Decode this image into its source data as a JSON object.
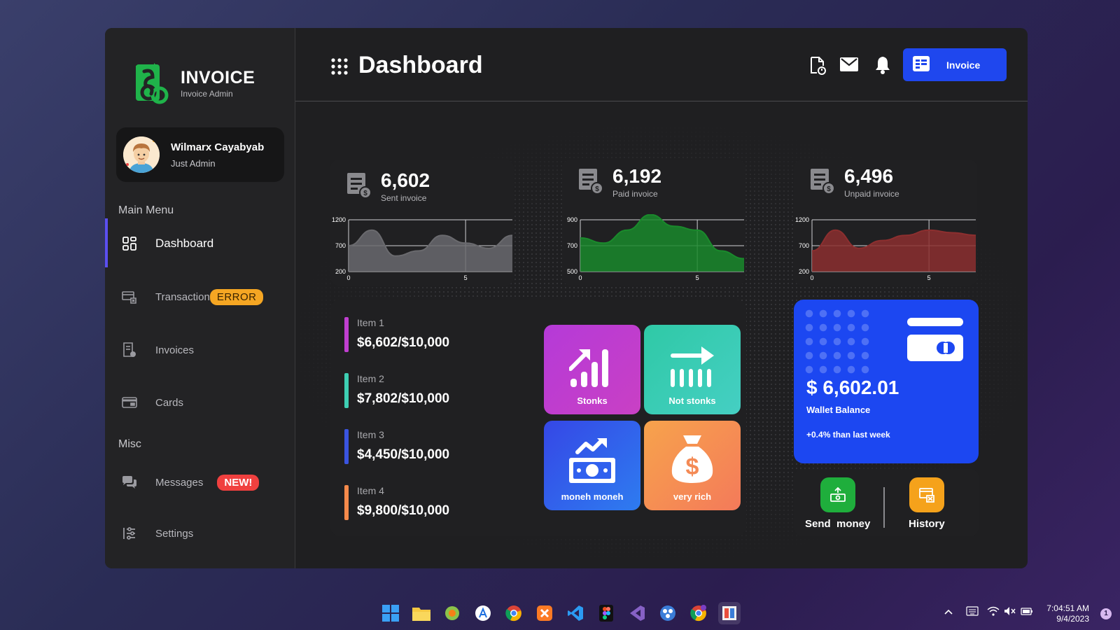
{
  "app": {
    "logo_title": "INVOICE",
    "logo_subtitle": "Invoice Admin"
  },
  "profile": {
    "name": "Wilmarx Cayabyab",
    "role": "Just Admin"
  },
  "sidebar": {
    "main_menu_label": "Main Menu",
    "misc_label": "Misc",
    "items": [
      {
        "label": "Dashboard",
        "icon": "dashboard-icon",
        "active": true
      },
      {
        "label": "Transaction",
        "icon": "transaction-icon",
        "badge": "ERROR"
      },
      {
        "label": "Invoices",
        "icon": "invoices-icon"
      },
      {
        "label": "Cards",
        "icon": "cards-icon"
      },
      {
        "label": "Messages",
        "icon": "messages-icon",
        "badge": "NEW!"
      },
      {
        "label": "Settings",
        "icon": "settings-icon"
      }
    ]
  },
  "header": {
    "title": "Dashboard",
    "invoice_button": "Invoice"
  },
  "stats": [
    {
      "value": "6,602",
      "label": "Sent invoice"
    },
    {
      "value": "6,192",
      "label": "Paid invoice"
    },
    {
      "value": "6,496",
      "label": "Unpaid invoice"
    }
  ],
  "chart_data": [
    {
      "type": "area",
      "x": [
        0,
        1,
        2,
        3,
        4,
        5,
        6,
        7
      ],
      "values": [
        700,
        1000,
        500,
        600,
        900,
        750,
        650,
        900
      ],
      "ylim": [
        200,
        1200
      ],
      "yticks": [
        "1200",
        "700",
        "200"
      ],
      "xticks": [
        "0",
        "5"
      ],
      "color": "#6a6a6e"
    },
    {
      "type": "area",
      "x": [
        0,
        1,
        2,
        3,
        4,
        5,
        6,
        7
      ],
      "values": [
        760,
        720,
        820,
        940,
        850,
        820,
        660,
        600
      ],
      "ylim": [
        500,
        900
      ],
      "yticks": [
        "900",
        "700",
        "500"
      ],
      "xticks": [
        "0",
        "5"
      ],
      "color": "#1a8a2c"
    },
    {
      "type": "area",
      "x": [
        0,
        1,
        2,
        3,
        4,
        5,
        6,
        7
      ],
      "values": [
        600,
        1000,
        650,
        800,
        900,
        1000,
        950,
        900
      ],
      "ylim": [
        200,
        1200
      ],
      "yticks": [
        "1200",
        "700",
        "200"
      ],
      "xticks": [
        "0",
        "5"
      ],
      "color": "#8c2f2f"
    }
  ],
  "items": [
    {
      "name": "Item 1",
      "value": "$6,602/$10,000",
      "color": "#c03fd0"
    },
    {
      "name": "Item 2",
      "value": "$7,802/$10,000",
      "color": "#3ecfb3"
    },
    {
      "name": "Item 3",
      "value": "$4,450/$10,000",
      "color": "#3a54e0"
    },
    {
      "name": "Item 4",
      "value": "$9,800/$10,000",
      "color": "#f58a4b"
    }
  ],
  "tiles": [
    {
      "label": "Stonks"
    },
    {
      "label": "Not stonks"
    },
    {
      "label": "moneh moneh"
    },
    {
      "label": "very rich"
    }
  ],
  "wallet": {
    "amount": "$ 6,602.01",
    "label": "Wallet Balance",
    "change": "+0.4% than last week"
  },
  "actions": {
    "send": "Send  money",
    "history": "History"
  },
  "taskbar": {
    "time": "7:04:51 AM",
    "date": "9/4/2023",
    "notifications": "1"
  }
}
